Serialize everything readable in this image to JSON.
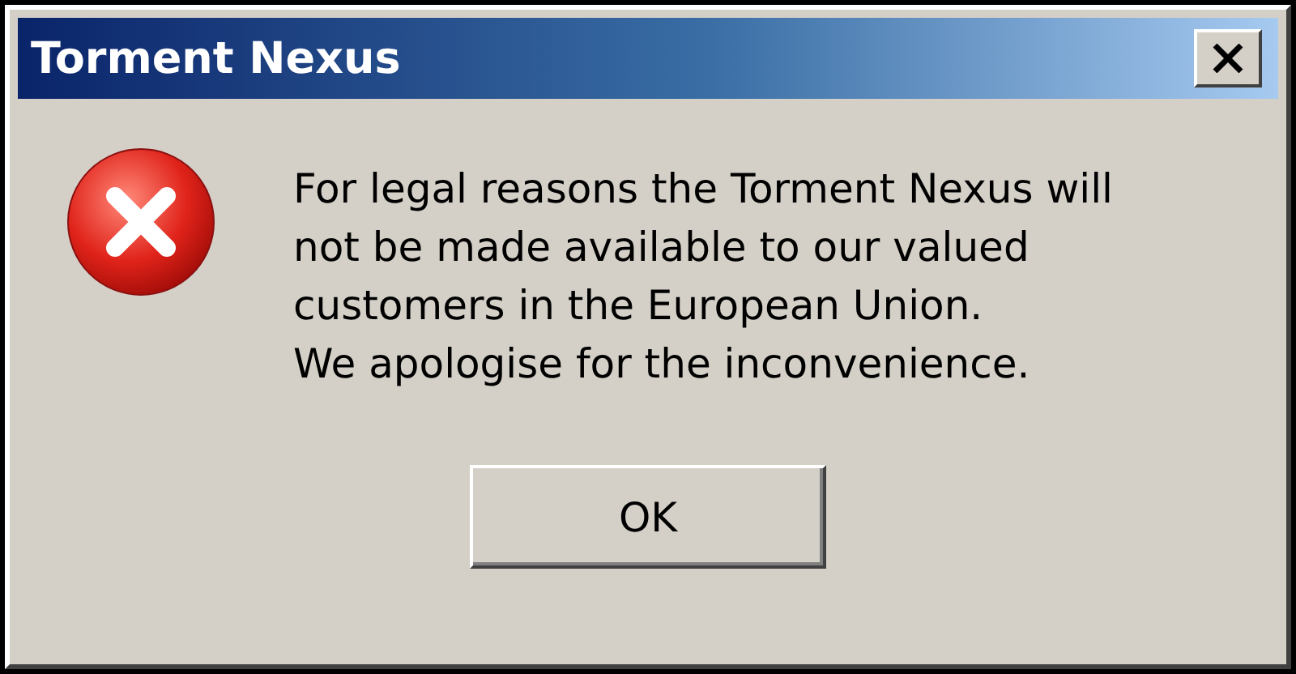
{
  "window": {
    "title": "Torment Nexus"
  },
  "message": {
    "kind": "error",
    "lines": [
      "For legal reasons the Torment Nexus will",
      "not be made available to our valued",
      "customers in the European Union.",
      "We apologise for the inconvenience."
    ]
  },
  "buttons": [
    {
      "label": "OK"
    }
  ]
}
